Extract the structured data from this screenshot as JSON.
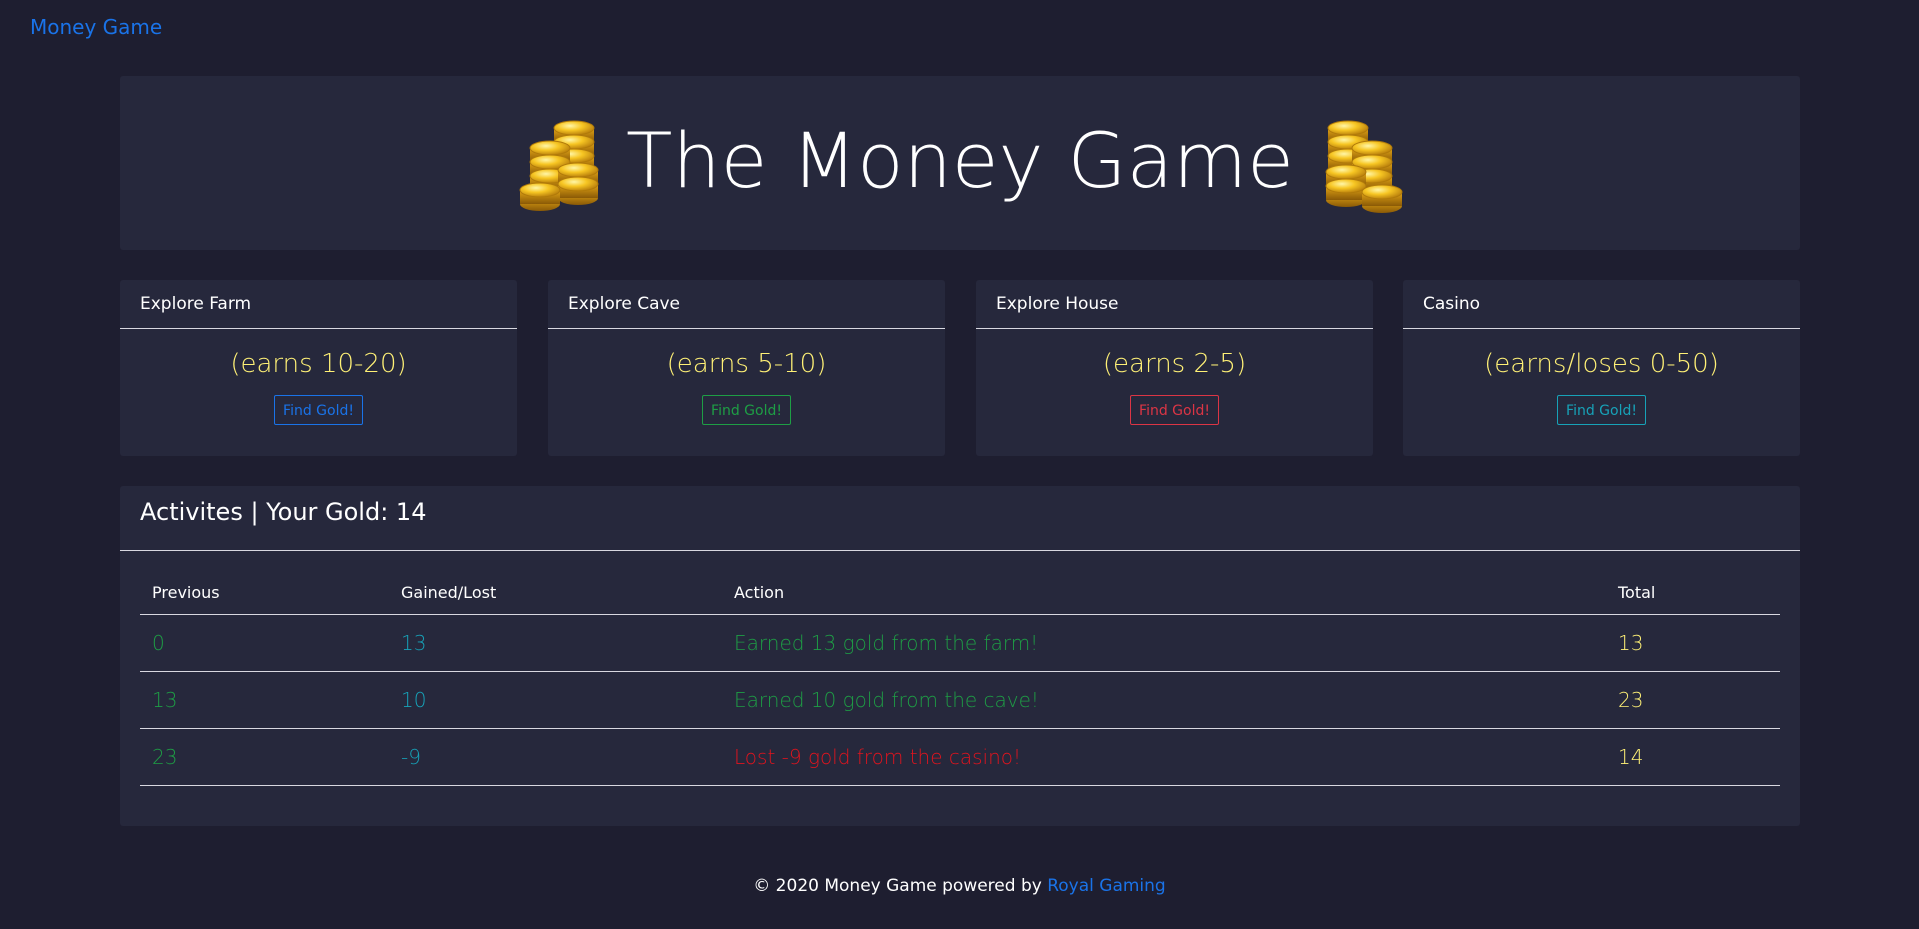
{
  "nav": {
    "brand": "Money Game"
  },
  "hero": {
    "title": "The Money Game"
  },
  "cards": [
    {
      "title": "Explore Farm",
      "earn": "(earns 10-20)",
      "button": "Find Gold!",
      "color": "#1a73e8"
    },
    {
      "title": "Explore Cave",
      "earn": "(earns 5-10)",
      "button": "Find Gold!",
      "color": "#1e9e45"
    },
    {
      "title": "Explore House",
      "earn": "(earns 2-5)",
      "button": "Find Gold!",
      "color": "#dc3545"
    },
    {
      "title": "Casino",
      "earn": "(earns/loses 0-50)",
      "button": "Find Gold!",
      "color": "#17a2b8"
    }
  ],
  "activities": {
    "header": "Activites | Your Gold: 14",
    "columns": [
      "Previous",
      "Gained/Lost",
      "Action",
      "Total"
    ],
    "rows": [
      {
        "previous": "0",
        "gained": "13",
        "action": "Earned 13 gold from the farm!",
        "total": "13",
        "kind": "earn"
      },
      {
        "previous": "13",
        "gained": "10",
        "action": "Earned 10 gold from the cave!",
        "total": "23",
        "kind": "earn"
      },
      {
        "previous": "23",
        "gained": "-9",
        "action": "Lost -9 gold from the casino!",
        "total": "14",
        "kind": "loss"
      }
    ]
  },
  "footer": {
    "text": "© 2020 Money Game powered by ",
    "link": "Royal Gaming"
  },
  "colors": {
    "background": "#1e1e30",
    "panel": "#26283c",
    "accent_blue": "#1a73e8",
    "yellow": "#fff176",
    "green": "#1e9e45",
    "red": "#e0141e",
    "teal": "#17a2b8"
  },
  "icons": {
    "hero_left": "gold-coins-icon",
    "hero_right": "gold-coins-icon"
  }
}
